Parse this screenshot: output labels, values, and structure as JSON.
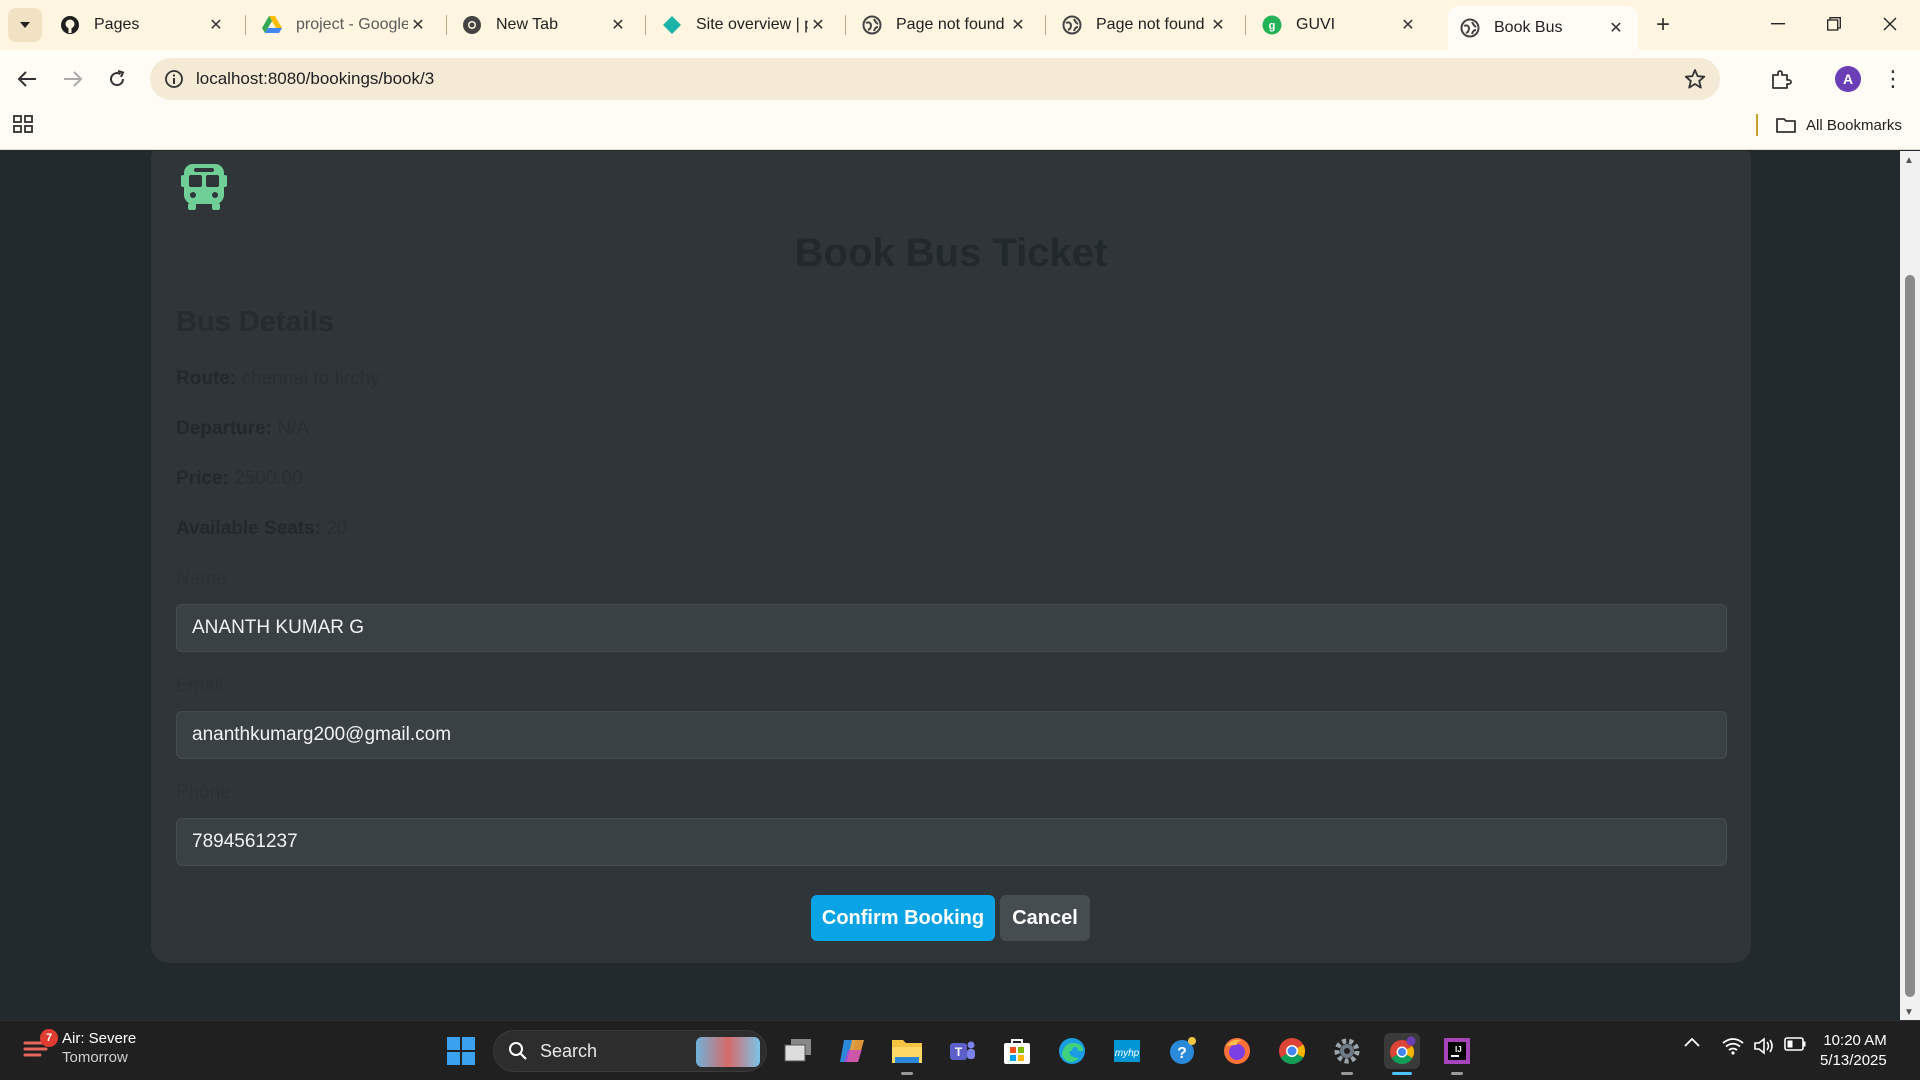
{
  "browser": {
    "tabs": [
      {
        "title": "Pages",
        "icon": "github-icon"
      },
      {
        "title": "project - Google",
        "icon": "google-drive-icon"
      },
      {
        "title": "New Tab",
        "icon": "chrome-icon"
      },
      {
        "title": "Site overview | p",
        "icon": "netlify-icon"
      },
      {
        "title": "Page not found",
        "icon": "globe-icon"
      },
      {
        "title": "Page not found",
        "icon": "globe-icon"
      },
      {
        "title": "GUVI",
        "icon": "guvi-icon"
      },
      {
        "title": "Book Bus",
        "icon": "globe-icon",
        "active": true
      }
    ],
    "url": "localhost:8080/bookings/book/3",
    "profile_initial": "A",
    "all_bookmarks_label": "All Bookmarks"
  },
  "page": {
    "title": "Book Bus Ticket",
    "bus_details_heading": "Bus Details",
    "details": [
      {
        "label": "Route:",
        "value": "chennai to tirchy"
      },
      {
        "label": "Departure:",
        "value": "N/A"
      },
      {
        "label": "Price:",
        "value": "2500.00"
      },
      {
        "label": "Available Seats:",
        "value": "20"
      }
    ],
    "form": {
      "name_label": "Name",
      "name_value": "ANANTH KUMAR G",
      "email_label": "Email",
      "email_value": "ananthkumarg200@gmail.com",
      "phone_label": "Phone",
      "phone_value": "7894561237"
    },
    "confirm_label": "Confirm Booking",
    "cancel_label": "Cancel"
  },
  "colors": {
    "accent": "#0aa3e6",
    "logo": "#6fcf97",
    "card": "#2f3538",
    "background": "#222a2e"
  },
  "taskbar": {
    "weather_title": "Air: Severe",
    "weather_sub": "Tomorrow",
    "weather_badge": "7",
    "search_placeholder": "Search",
    "time": "10:20 AM",
    "date": "5/13/2025"
  }
}
